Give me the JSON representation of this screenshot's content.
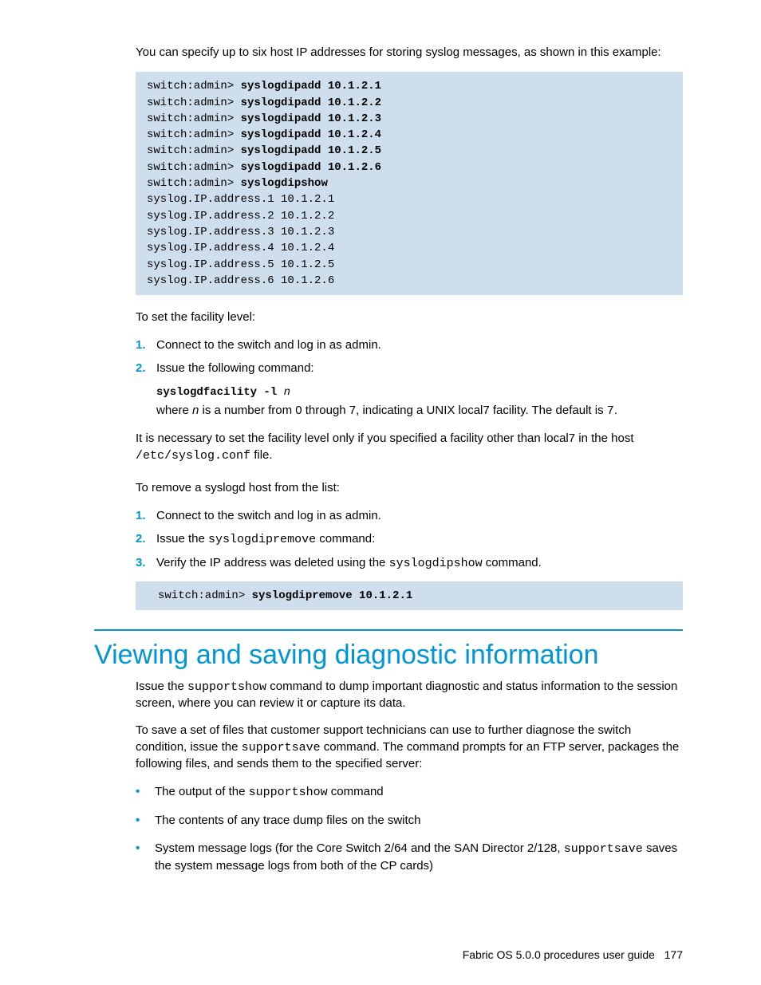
{
  "intro": "You can specify up to six host IP addresses for storing syslog messages, as shown in this example:",
  "code1": {
    "prompt": "switch:admin> ",
    "cmds": [
      "syslogdipadd 10.1.2.1",
      "syslogdipadd 10.1.2.2",
      "syslogdipadd 10.1.2.3",
      "syslogdipadd 10.1.2.4",
      "syslogdipadd 10.1.2.5",
      "syslogdipadd 10.1.2.6",
      "syslogdipshow"
    ],
    "output": [
      "syslog.IP.address.1 10.1.2.1",
      "syslog.IP.address.2 10.1.2.2",
      "syslog.IP.address.3 10.1.2.3",
      "syslog.IP.address.4 10.1.2.4",
      "syslog.IP.address.5 10.1.2.5",
      "syslog.IP.address.6 10.1.2.6"
    ]
  },
  "facility_intro": "To set the facility level:",
  "facility_steps": {
    "s1": "Connect to the switch and log in as admin.",
    "s2": "Issue the following command:",
    "cmd": "syslogdfacility -l ",
    "cmd_arg": "n",
    "where_a": "where ",
    "where_b": "n",
    "where_c": " is a number from 0 through 7, indicating a UNIX local7 facility. The default is ",
    "where_d": "7",
    "where_e": "."
  },
  "facility_note_a": "It is necessary to set the facility level only if you specified a facility other than local7 in the host ",
  "facility_note_b": "/etc/syslog.conf",
  "facility_note_c": " file.",
  "remove_intro": "To remove a syslogd host from the list:",
  "remove_steps": {
    "s1": "Connect to the switch and log in as admin.",
    "s2_a": "Issue the ",
    "s2_b": "syslogdipremove",
    "s2_c": " command:",
    "s3_a": "Verify the IP address was deleted using the ",
    "s3_b": "syslogdipshow",
    "s3_c": " command."
  },
  "code2": {
    "prompt": "switch:admin> ",
    "cmd": "syslogdipremove 10.1.2.1"
  },
  "heading": "Viewing and saving diagnostic information",
  "diag_p1_a": "Issue the ",
  "diag_p1_b": "supportshow",
  "diag_p1_c": " command to dump important diagnostic and status information to the session screen, where you can review it or capture its data.",
  "diag_p2_a": "To save a set of files that customer support technicians can use to further diagnose the switch condition, issue the ",
  "diag_p2_b": "supportsave",
  "diag_p2_c": " command. The command prompts for an FTP server, packages the following files, and sends them to the specified server:",
  "bullets": {
    "b1_a": "The output of the ",
    "b1_b": "supportshow",
    "b1_c": " command",
    "b2": "The contents of any trace dump files on the switch",
    "b3_a": "System message logs (for the Core Switch 2/64 and the SAN Director 2/128, ",
    "b3_b": "supportsave",
    "b3_c": " saves the system message logs from both of the CP cards)"
  },
  "footer_a": "Fabric OS 5.0.0 procedures user guide",
  "footer_b": "177"
}
